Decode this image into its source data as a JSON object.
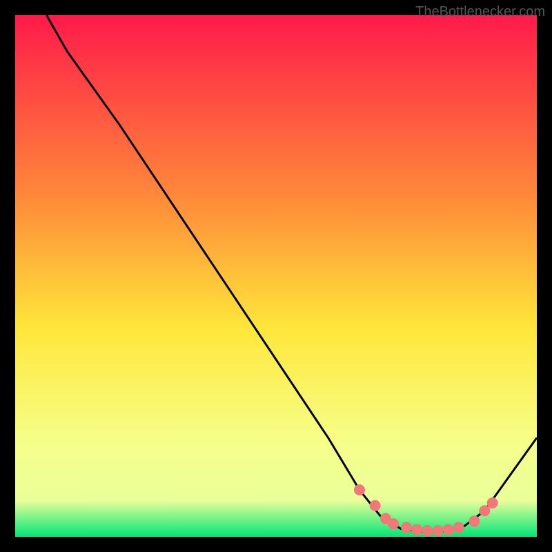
{
  "watermark": "TheBottlenecker.com",
  "chart_data": {
    "type": "line",
    "title": "",
    "xlabel": "",
    "ylabel": "",
    "xlim": [
      0,
      100
    ],
    "ylim": [
      0,
      100
    ],
    "background_gradient": {
      "top": "#ff1a4a",
      "upper_mid": "#ff8a3a",
      "mid": "#ffe63a",
      "lower_mid": "#f6ff8a",
      "bottom": "#00e676"
    },
    "curve": [
      {
        "x": 6,
        "y": 100
      },
      {
        "x": 10,
        "y": 93
      },
      {
        "x": 20,
        "y": 79
      },
      {
        "x": 30,
        "y": 64
      },
      {
        "x": 40,
        "y": 49
      },
      {
        "x": 50,
        "y": 34
      },
      {
        "x": 60,
        "y": 19
      },
      {
        "x": 66,
        "y": 9
      },
      {
        "x": 70,
        "y": 4
      },
      {
        "x": 74,
        "y": 1.5
      },
      {
        "x": 78,
        "y": 1
      },
      {
        "x": 82,
        "y": 1
      },
      {
        "x": 86,
        "y": 2
      },
      {
        "x": 90,
        "y": 5
      },
      {
        "x": 95,
        "y": 12
      },
      {
        "x": 100,
        "y": 19
      }
    ],
    "dots": [
      {
        "x": 66,
        "y": 9
      },
      {
        "x": 69,
        "y": 6
      },
      {
        "x": 71,
        "y": 3.5
      },
      {
        "x": 72.5,
        "y": 2.5
      },
      {
        "x": 75,
        "y": 1.8
      },
      {
        "x": 77,
        "y": 1.4
      },
      {
        "x": 79,
        "y": 1.2
      },
      {
        "x": 81,
        "y": 1.2
      },
      {
        "x": 83,
        "y": 1.4
      },
      {
        "x": 85,
        "y": 1.8
      },
      {
        "x": 88,
        "y": 3
      },
      {
        "x": 90,
        "y": 5
      },
      {
        "x": 91.5,
        "y": 6.5
      }
    ]
  }
}
